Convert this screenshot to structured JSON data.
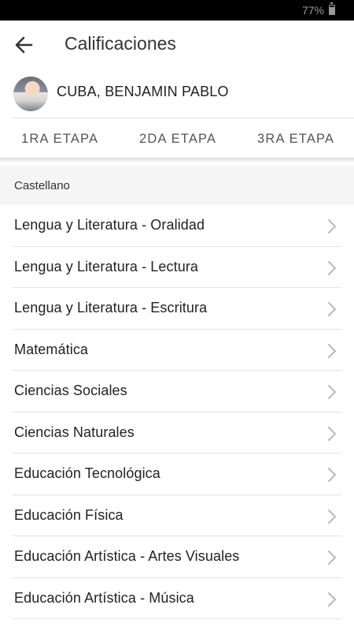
{
  "status_bar": {
    "battery": "77%"
  },
  "appbar": {
    "title": "Calificaciones",
    "back_icon": "arrow-left-icon"
  },
  "student": {
    "name": "CUBA, BENJAMIN PABLO"
  },
  "tabs": [
    {
      "label": "1RA ETAPA"
    },
    {
      "label": "2DA ETAPA"
    },
    {
      "label": "3RA ETAPA"
    }
  ],
  "section": {
    "title": "Castellano"
  },
  "subjects": [
    {
      "label": "Lengua y Literatura - Oralidad"
    },
    {
      "label": "Lengua y Literatura - Lectura"
    },
    {
      "label": "Lengua y Literatura - Escritura"
    },
    {
      "label": "Matemática"
    },
    {
      "label": "Ciencias Sociales"
    },
    {
      "label": "Ciencias Naturales"
    },
    {
      "label": "Educación Tecnológica"
    },
    {
      "label": "Educación Física"
    },
    {
      "label": "Educación Artística - Artes Visuales"
    },
    {
      "label": "Educación Artística - Música"
    }
  ]
}
